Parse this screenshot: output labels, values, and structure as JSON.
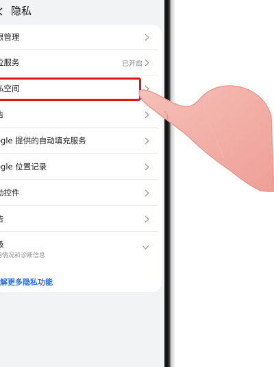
{
  "header": {
    "title": "隐私"
  },
  "rows": [
    {
      "label": "限管理",
      "status": ""
    },
    {
      "label": "位服务",
      "status": "已开启"
    },
    {
      "label": "私空间",
      "status": ""
    },
    {
      "label": "告",
      "status": ""
    },
    {
      "label": "ogle 提供的自动填充服务",
      "status": ""
    },
    {
      "label": "ogle 位置记录",
      "status": ""
    },
    {
      "label": "动控件",
      "status": ""
    },
    {
      "label": "告",
      "status": ""
    }
  ],
  "expandable": {
    "label": "级",
    "sub": "用情况和诊断信息"
  },
  "more_link": "解更多隐私功能",
  "colors": {
    "highlight": "#e0141a",
    "link": "#2a6fdb",
    "background": "#f1f3f5",
    "hand": "#f2aaa3"
  },
  "icons": [
    "back-arrow-icon",
    "chevron-right-icon",
    "chevron-down-icon",
    "pointing-hand-icon"
  ]
}
